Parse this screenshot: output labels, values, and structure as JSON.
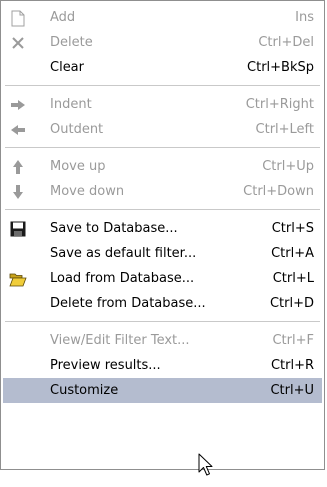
{
  "menu": {
    "items": [
      {
        "label": "Add",
        "shortcut": "Ins",
        "icon": "new-document-icon"
      },
      {
        "label": "Delete",
        "shortcut": "Ctrl+Del",
        "icon": "delete-x-icon"
      },
      {
        "label": "Clear",
        "shortcut": "Ctrl+BkSp"
      },
      {
        "label": "Indent",
        "shortcut": "Ctrl+Right",
        "icon": "arrow-right-icon"
      },
      {
        "label": "Outdent",
        "shortcut": "Ctrl+Left",
        "icon": "arrow-left-icon"
      },
      {
        "label": "Move up",
        "shortcut": "Ctrl+Up",
        "icon": "arrow-up-icon"
      },
      {
        "label": "Move down",
        "shortcut": "Ctrl+Down",
        "icon": "arrow-down-icon"
      },
      {
        "label": "Save to Database...",
        "shortcut": "Ctrl+S",
        "icon": "floppy-disk-icon"
      },
      {
        "label": "Save as default filter...",
        "shortcut": "Ctrl+A"
      },
      {
        "label": "Load from Database...",
        "shortcut": "Ctrl+L",
        "icon": "open-folder-icon"
      },
      {
        "label": "Delete from Database...",
        "shortcut": "Ctrl+D"
      },
      {
        "label": "View/Edit Filter Text...",
        "shortcut": "Ctrl+F"
      },
      {
        "label": "Preview results...",
        "shortcut": "Ctrl+R"
      },
      {
        "label": "Customize",
        "shortcut": "Ctrl+U"
      }
    ],
    "disabled_items": [
      "Add",
      "Delete",
      "Indent",
      "Outdent",
      "Move up",
      "Move down",
      "View/Edit Filter Text..."
    ],
    "highlighted_item": "Customize"
  },
  "colors": {
    "disabled_text": "#9a9a9a",
    "highlight_background": "#b4bccf",
    "separator": "#c9c9c9",
    "border": "#8f8f8f"
  }
}
